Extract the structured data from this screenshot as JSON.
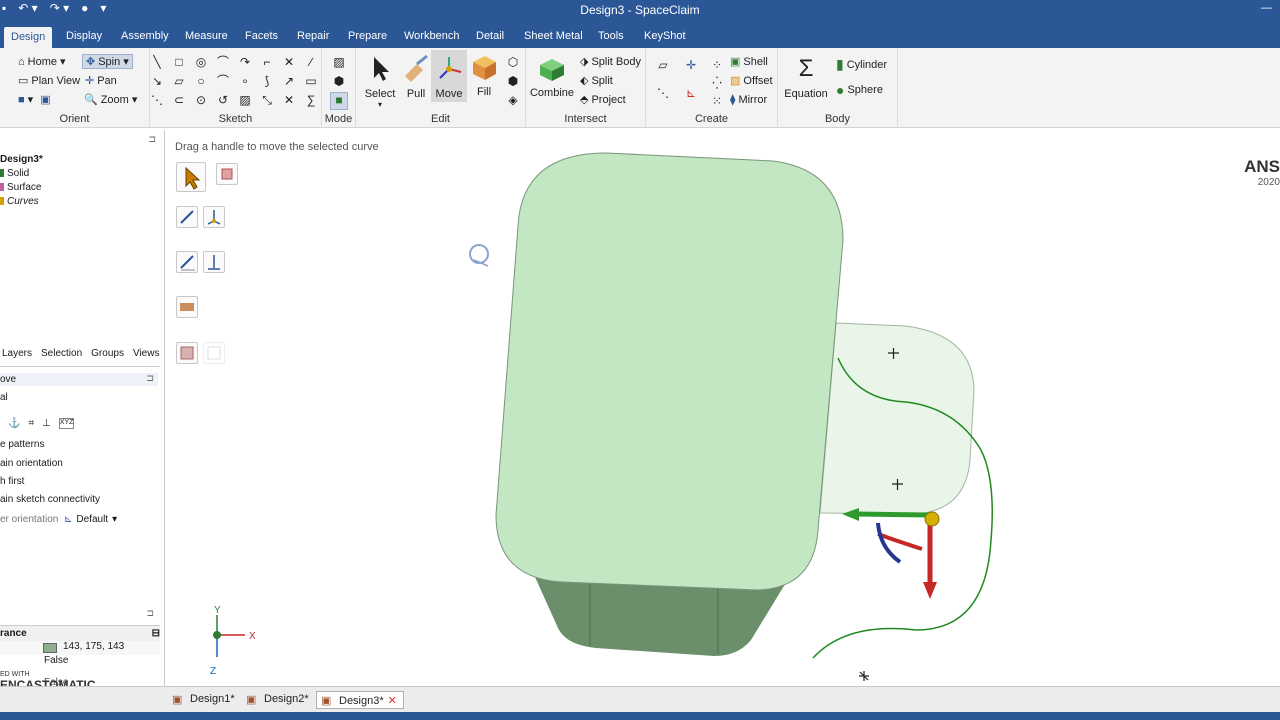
{
  "window": {
    "title": "Design3 - SpaceClaim"
  },
  "tabs": [
    "Design",
    "Display",
    "Assembly",
    "Measure",
    "Facets",
    "Repair",
    "Prepare",
    "Workbench",
    "Detail",
    "Sheet Metal",
    "Tools",
    "KeyShot"
  ],
  "ribbon": {
    "orient": {
      "label": "Orient",
      "home": "Home",
      "spin": "Spin",
      "plan_view": "Plan View",
      "pan": "Pan",
      "zoom": "Zoom"
    },
    "sketch": {
      "label": "Sketch"
    },
    "mode": {
      "label": "Mode"
    },
    "edit": {
      "label": "Edit",
      "select": "Select",
      "pull": "Pull",
      "move": "Move",
      "fill": "Fill"
    },
    "intersect": {
      "label": "Intersect",
      "combine": "Combine",
      "split_body": "Split Body",
      "split": "Split",
      "project": "Project"
    },
    "create": {
      "label": "Create",
      "shell": "Shell",
      "offset": "Offset",
      "mirror": "Mirror"
    },
    "body": {
      "label": "Body",
      "equation": "Equation",
      "cylinder": "Cylinder",
      "sphere": "Sphere"
    }
  },
  "structure": {
    "root": "Design3*",
    "items": [
      "Solid",
      "Surface",
      "Curves"
    ]
  },
  "panel_tabs": [
    "Layers",
    "Selection",
    "Groups",
    "Views"
  ],
  "options": {
    "title": "ove",
    "row2": "al",
    "items": [
      "e patterns",
      "ain orientation",
      "h first",
      "ain sketch connectivity"
    ],
    "orientation_label": "er orientation",
    "orientation_value": "Default"
  },
  "properties": {
    "header": "rance",
    "color_value": "143, 175, 143",
    "false_value": "False",
    "false_value2": "False",
    "watermark": "ED WITH",
    "watermark2": "ENCASTOMATIC"
  },
  "viewport": {
    "hint": "Drag a handle to move the selected curve",
    "brand": "ANS",
    "brand_year": "2020",
    "triad": {
      "y": "Y",
      "x": "X",
      "z": "Z"
    }
  },
  "doc_tabs": [
    "Design1*",
    "Design2*",
    "Design3*"
  ],
  "colors": {
    "accent": "#2b5797",
    "body_face": "#c3e6c3",
    "body_side": "#6b8f6b",
    "surface": "#e8f5e8",
    "curve": "#1f8a1f"
  }
}
